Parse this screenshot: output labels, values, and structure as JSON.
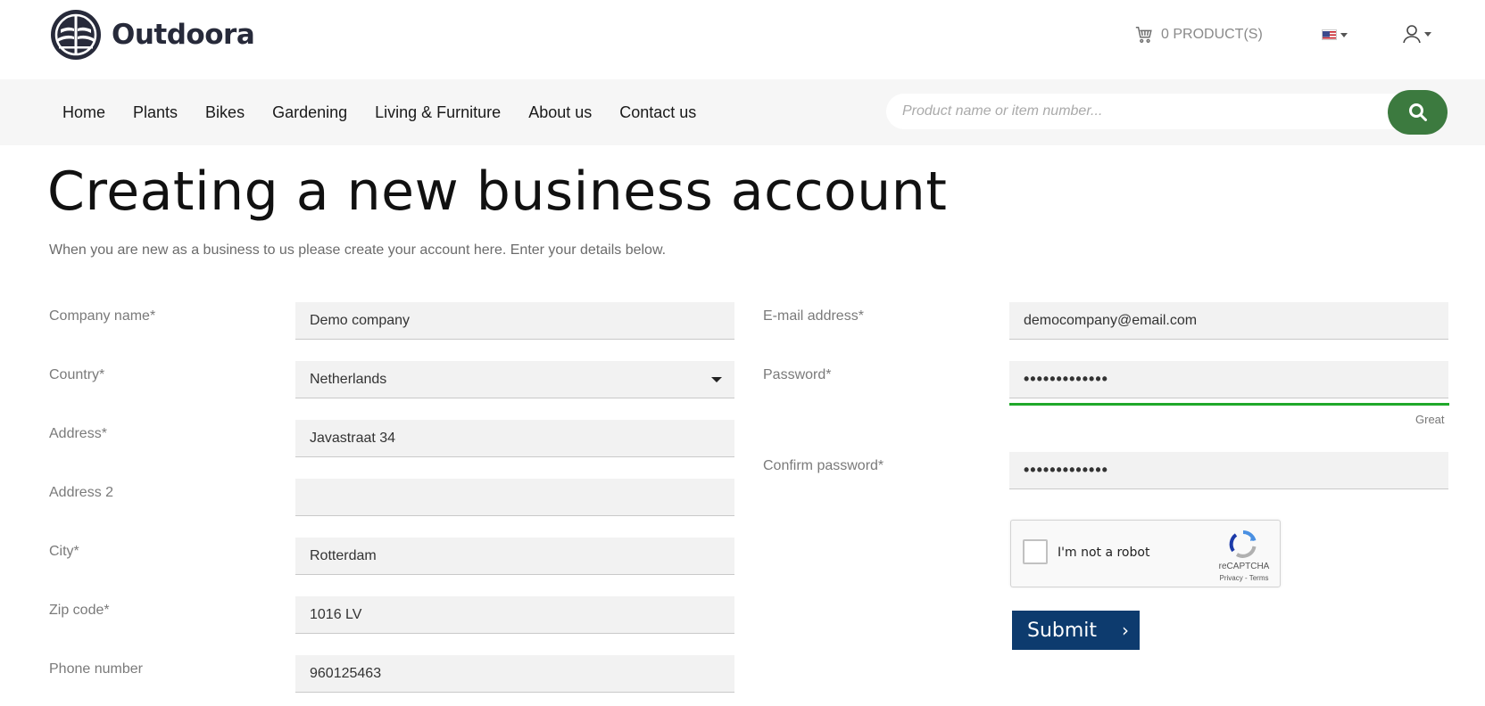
{
  "brand": {
    "name": "Outdoora"
  },
  "header": {
    "cart_label": "0 PRODUCT(S)"
  },
  "nav": {
    "items": [
      "Home",
      "Plants",
      "Bikes",
      "Gardening",
      "Living & Furniture",
      "About us",
      "Contact us"
    ]
  },
  "search": {
    "placeholder": "Product name or item number..."
  },
  "page": {
    "title": "Creating a new business account",
    "subtitle": "When you are new as a business to us please create your account here. Enter your details below."
  },
  "form": {
    "company_name": {
      "label": "Company name*",
      "value": "Demo company"
    },
    "country": {
      "label": "Country*",
      "value": "Netherlands"
    },
    "address": {
      "label": "Address*",
      "value": "Javastraat 34"
    },
    "address2": {
      "label": "Address 2",
      "value": ""
    },
    "city": {
      "label": "City*",
      "value": "Rotterdam"
    },
    "zip": {
      "label": "Zip code*",
      "value": "1016 LV"
    },
    "phone": {
      "label": "Phone number",
      "value": "960125463"
    },
    "email": {
      "label": "E-mail address*",
      "value": "democompany@email.com"
    },
    "password": {
      "label": "Password*",
      "value": "•••••••••••••",
      "strength": "Great"
    },
    "confirm_password": {
      "label": "Confirm password*",
      "value": "•••••••••••••"
    },
    "captcha": {
      "label": "I'm not a robot",
      "brand": "reCAPTCHA",
      "links": "Privacy - Terms"
    },
    "submit_label": "Submit",
    "submit_arrow": "›"
  },
  "colors": {
    "accent_green": "#3c7a3f",
    "submit_blue": "#0d3b6e",
    "strength_green": "#1fa82a"
  }
}
